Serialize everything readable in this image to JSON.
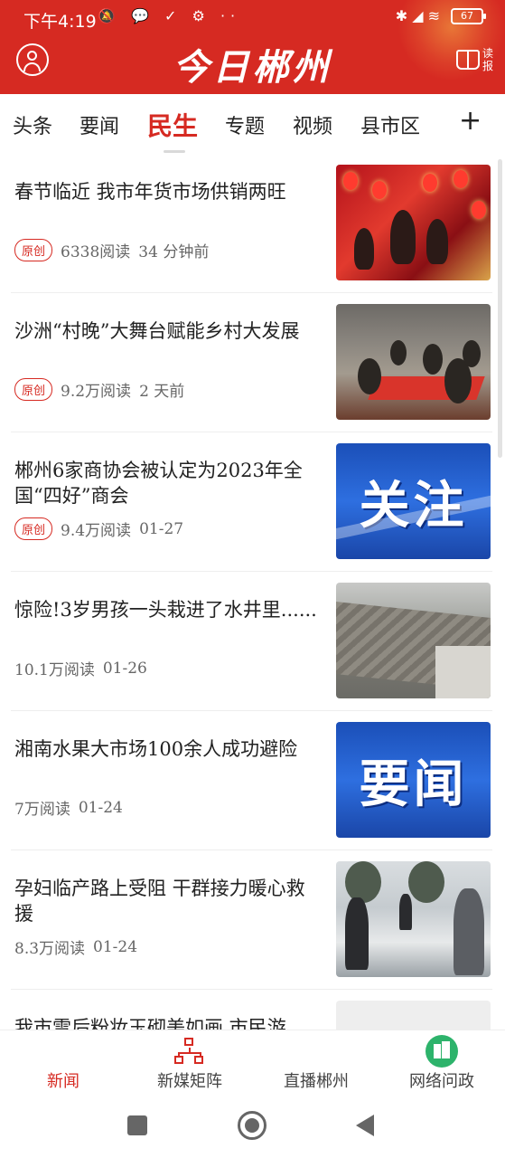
{
  "status_bar": {
    "time": "下午4:19",
    "left_icons": [
      "muted-bell-icon",
      "chat-icon",
      "check-icon",
      "gear-icon",
      "more-icon"
    ],
    "left_icons_text": "🔕 💬 ✓ ⚙ ··",
    "right_icons_text": "✱  ◢  ≋",
    "battery": "67"
  },
  "header": {
    "logo": "今日郴州",
    "read_label": "读报",
    "brand_color": "#d62a22"
  },
  "tabs": {
    "items": [
      "头条",
      "要闻",
      "民生",
      "专题",
      "视频",
      "县市区"
    ],
    "active": "民生",
    "plus": "+"
  },
  "feed": [
    {
      "title": "春节临近 我市年货市场供销两旺",
      "badge": "原创",
      "reads": "6338阅读",
      "time": "34 分钟前",
      "image": "new-year-market-photo"
    },
    {
      "title": "沙洲“村晚”大舞台赋能乡村大发展",
      "badge": "原创",
      "reads": "9.2万阅读",
      "time": "2 天前",
      "image": "village-gala-photo"
    },
    {
      "title": "郴州6家商协会被认定为2023年全国“四好”商会",
      "badge": "原创",
      "reads": "9.4万阅读",
      "time": "01-27",
      "image": "guanzhu-banner",
      "image_text": "关注"
    },
    {
      "title": "惊险!3岁男孩一头栽进了水井里......",
      "badge": "",
      "reads": "10.1万阅读",
      "time": "01-26",
      "image": "well-site-photo"
    },
    {
      "title": "湘南水果大市场100余人成功避险",
      "badge": "",
      "reads": "7万阅读",
      "time": "01-24",
      "image": "yaowen-banner",
      "image_text": "要闻"
    },
    {
      "title": "孕妇临产路上受阻 干群接力暖心救援",
      "badge": "",
      "reads": "8.3万阅读",
      "time": "01-24",
      "image": "snow-rescue-photo"
    },
    {
      "title": "我市雪后粉妆玉砌美如画 市民游",
      "badge": "",
      "reads": "",
      "time": "",
      "image": "placeholder"
    }
  ],
  "bottom_nav": {
    "items": [
      "新闻",
      "新媒矩阵",
      "直播郴州",
      "网络问政"
    ],
    "active": "新闻"
  }
}
